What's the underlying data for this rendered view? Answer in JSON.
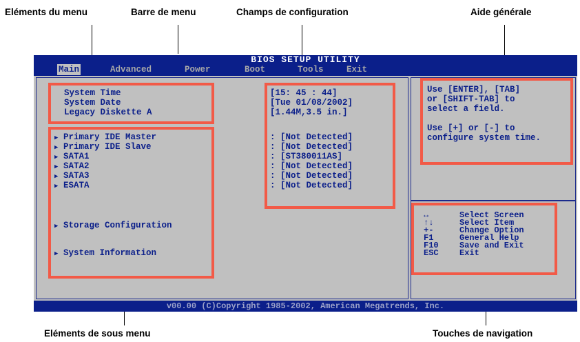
{
  "callouts": {
    "menu_items": "Eléments du menu",
    "menu_bar": "Barre de menu",
    "config_fields": "Champs de configuration",
    "general_help": "Aide générale",
    "submenu_items": "Eléments de sous menu",
    "nav_keys": "Touches de navigation"
  },
  "bios": {
    "title": "BIOS SETUP UTILITY",
    "menus": [
      "Main",
      "Advanced",
      "Power",
      "Boot",
      "Tools",
      "Exit"
    ],
    "active_menu": "Main",
    "items": [
      {
        "label": "System Time",
        "value": "[15: 45 : 44]"
      },
      {
        "label": "System Date",
        "value": "[Tue 01/08/2002]"
      },
      {
        "label": "Legacy Diskette A",
        "value": "[1.44M,3.5 in.]"
      }
    ],
    "submenu_items": [
      {
        "label": "Primary IDE Master",
        "value": ": [Not Detected]"
      },
      {
        "label": "Primary IDE Slave",
        "value": ": [Not Detected]"
      },
      {
        "label": "SATA1",
        "value": ": [ST380011AS]"
      },
      {
        "label": "SATA2",
        "value": ": [Not Detected]"
      },
      {
        "label": "SATA3",
        "value": ": [Not Detected]"
      },
      {
        "label": "ESATA",
        "value": ": [Not Detected]"
      }
    ],
    "storage_config": "Storage Configuration",
    "system_info": "System Information",
    "help_text": [
      "Use [ENTER], [TAB]",
      "or [SHIFT-TAB] to",
      "select a field.",
      "",
      "Use [+] or [-] to",
      "configure system time."
    ],
    "nav": [
      {
        "key": "↔",
        "desc": "Select Screen"
      },
      {
        "key": "↑↓",
        "desc": "Select Item"
      },
      {
        "key": "+-",
        "desc": "Change Option"
      },
      {
        "key": "F1",
        "desc": "General Help"
      },
      {
        "key": "F10",
        "desc": "Save and Exit"
      },
      {
        "key": "ESC",
        "desc": "Exit"
      }
    ],
    "copyright": "v00.00 (C)Copyright 1985-2002, American Megatrends, Inc."
  },
  "colors": {
    "bios_blue": "#0b1f8a",
    "bios_gray": "#c0c0c0",
    "highlight_red": "#f25a47"
  }
}
